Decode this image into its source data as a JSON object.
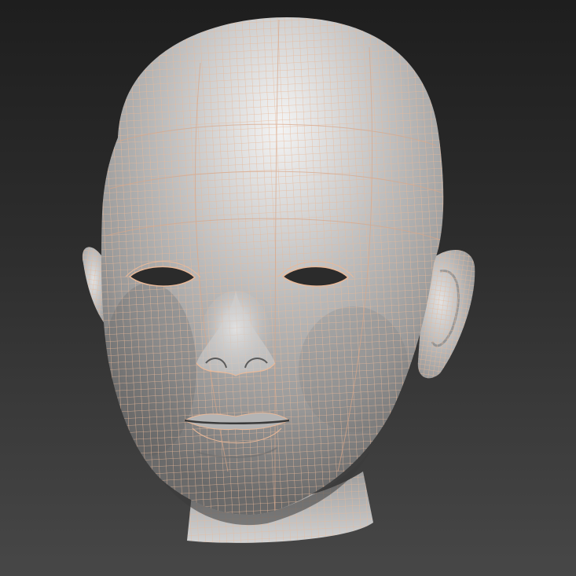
{
  "viewport": {
    "background_top": "#1e1e1e",
    "background_bottom": "#474747"
  },
  "model": {
    "subject": "infant-head-mesh",
    "render_mode": "smooth-shaded-with-wireframe",
    "shade_color": "#a8a8a8",
    "wire_color": "#e9b999"
  }
}
